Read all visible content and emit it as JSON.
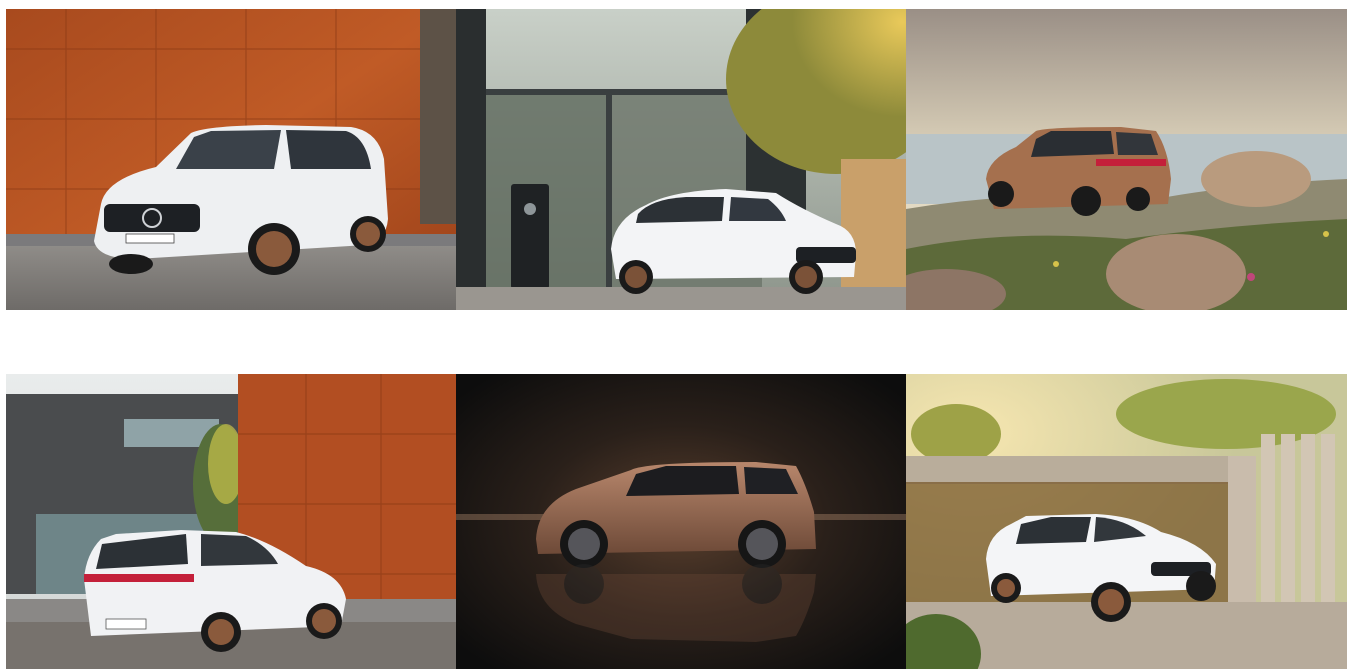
{
  "gallery": {
    "items": [
      {
        "subject": "white-suv",
        "setting": "rust-wall",
        "colors": {
          "car": "#f2f3f5",
          "wheels": "#8a5a3c",
          "wall": "#b5501f"
        }
      },
      {
        "subject": "white-suv",
        "setting": "glass-house-charger",
        "colors": {
          "car": "#f4f5f7",
          "wheels": "#7b5238",
          "foliage": "#c9a43a"
        }
      },
      {
        "subject": "bronze-suv",
        "setting": "coastal-cliff-sunset",
        "colors": {
          "car": "#a5704e",
          "sky": "#d8cdb6",
          "sea": "#b9c4c7"
        }
      },
      {
        "subject": "white-suv",
        "setting": "rust-wall-rear",
        "colors": {
          "car": "#f1f2f4",
          "wheels": "#8a5a3c",
          "wall": "#b24e22"
        }
      },
      {
        "subject": "bronze-suv",
        "setting": "dark-studio",
        "colors": {
          "car": "#9c6d55",
          "background": "#161616"
        }
      },
      {
        "subject": "white-suv",
        "setting": "concrete-carport",
        "colors": {
          "car": "#f4f5f7",
          "wheels": "#8a5a3c",
          "concrete": "#c8bcac"
        }
      }
    ]
  }
}
